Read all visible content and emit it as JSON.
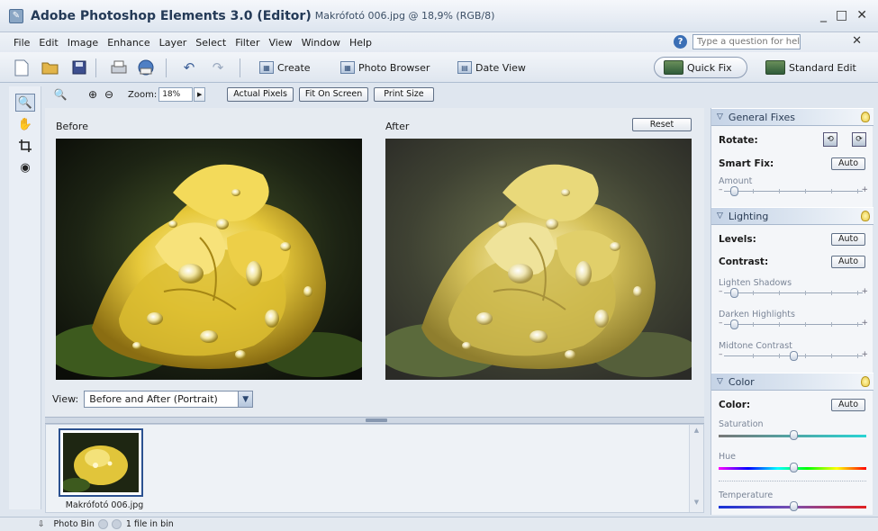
{
  "title": {
    "app": "Adobe Photoshop Elements 3.0 (Editor)",
    "document": "Makrófotó 006.jpg @ 18,9% (RGB/8)"
  },
  "window_controls": [
    "_",
    "□",
    "✕"
  ],
  "menu": [
    "File",
    "Edit",
    "Image",
    "Enhance",
    "Layer",
    "Select",
    "Filter",
    "View",
    "Window",
    "Help"
  ],
  "help": {
    "placeholder": "Type a question for help",
    "close": "✕"
  },
  "toolbar": {
    "create": "Create",
    "photo_browser": "Photo Browser",
    "date_view": "Date View",
    "quick_fix": "Quick Fix",
    "standard_edit": "Standard Edit"
  },
  "options": {
    "zoom_label": "Zoom:",
    "zoom_value": "18%",
    "actual_pixels": "Actual Pixels",
    "fit_on_screen": "Fit On Screen",
    "print_size": "Print Size"
  },
  "canvas": {
    "before": "Before",
    "after": "After",
    "reset": "Reset",
    "view_label": "View:",
    "view_value": "Before and After (Portrait)"
  },
  "bin": {
    "caption": "Makrófotó 006.jpg"
  },
  "palette": {
    "general": {
      "title": "General Fixes",
      "rotate": "Rotate:",
      "smart_fix": "Smart Fix:",
      "auto": "Auto",
      "amount": "Amount",
      "amount_level": 0.08
    },
    "lighting": {
      "title": "Lighting",
      "levels": "Levels:",
      "contrast": "Contrast:",
      "auto": "Auto",
      "lighten_shadows": "Lighten Shadows",
      "lighten_level": 0.08,
      "darken_highlights": "Darken Highlights",
      "darken_level": 0.08,
      "midtone_contrast": "Midtone Contrast",
      "midtone_level": 0.5
    },
    "color": {
      "title": "Color",
      "color": "Color:",
      "auto": "Auto",
      "saturation": "Saturation",
      "saturation_level": 0.5,
      "hue": "Hue",
      "hue_level": 0.5,
      "temperature": "Temperature",
      "temperature_level": 0.5
    }
  },
  "status": {
    "photo_bin": "Photo Bin",
    "count": "1 file in bin"
  },
  "colors": {
    "accent": "#2b5190",
    "flower_yellow": "#e7cc3a",
    "leaf_green": "#5b7a2a"
  }
}
